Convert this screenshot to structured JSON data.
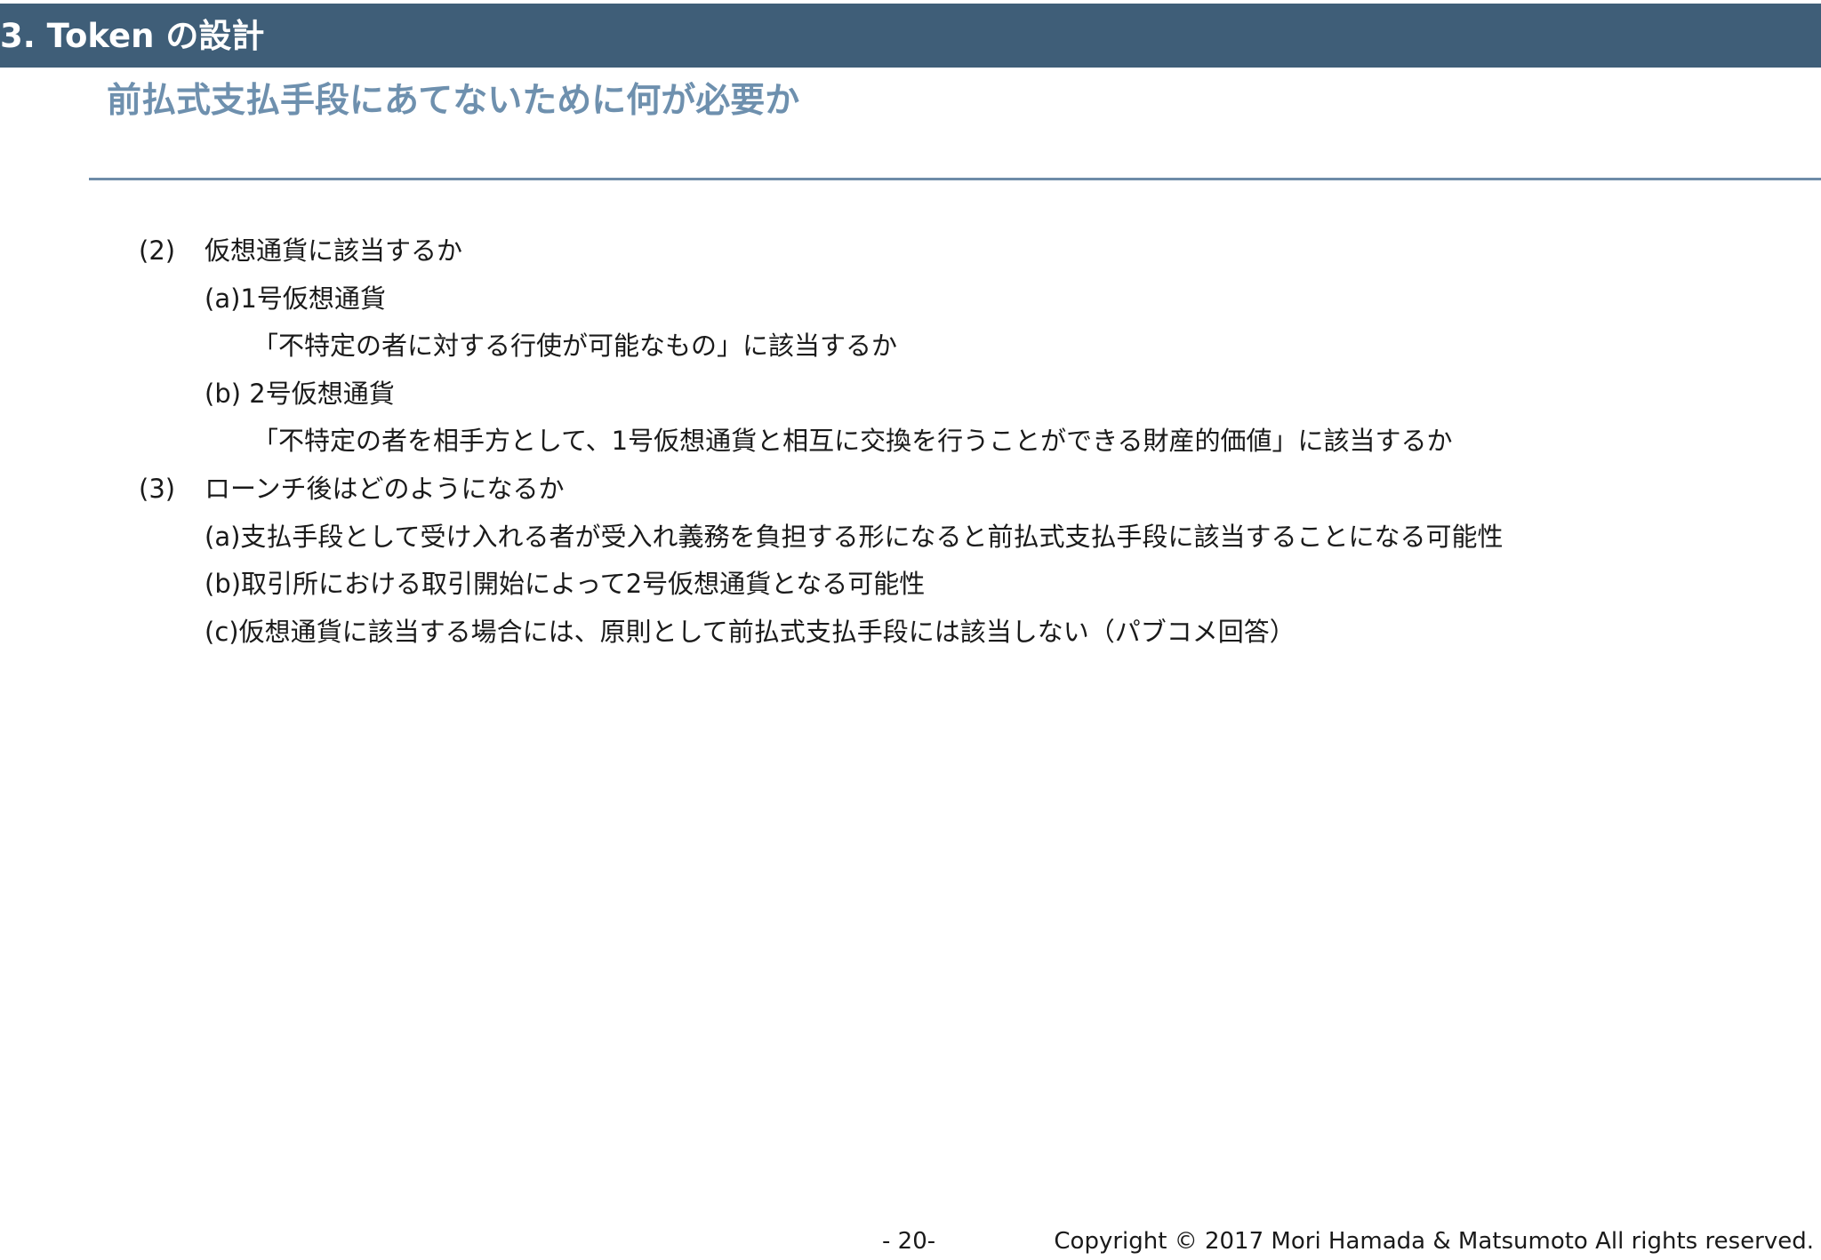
{
  "header": {
    "section_title": "3. Token の設計"
  },
  "slide": {
    "title": "前払式支払手段にあてないために何が必要か"
  },
  "content": {
    "item2": {
      "number": "(2)",
      "text": "仮想通貨に該当するか",
      "sub_a": "(a)1号仮想通貨",
      "sub_a_detail": "「不特定の者に対する行使が可能なもの」に該当するか",
      "sub_b": "(b) 2号仮想通貨",
      "sub_b_detail": "「不特定の者を相手方として、1号仮想通貨と相互に交換を行うことができる財産的価値」に該当するか"
    },
    "item3": {
      "number": "(3)",
      "text": "ローンチ後はどのようになるか",
      "sub_a": "(a)支払手段として受け入れる者が受入れ義務を負担する形になると前払式支払手段に該当することになる可能性",
      "sub_b": "(b)取引所における取引開始によって2号仮想通貨となる可能性",
      "sub_c": "(c)仮想通貨に該当する場合には、原則として前払式支払手段には該当しない（パブコメ回答）"
    }
  },
  "footer": {
    "page_number": "- 20-",
    "copyright": "Copyright © 2017 Mori Hamada & Matsumoto  All rights reserved."
  }
}
